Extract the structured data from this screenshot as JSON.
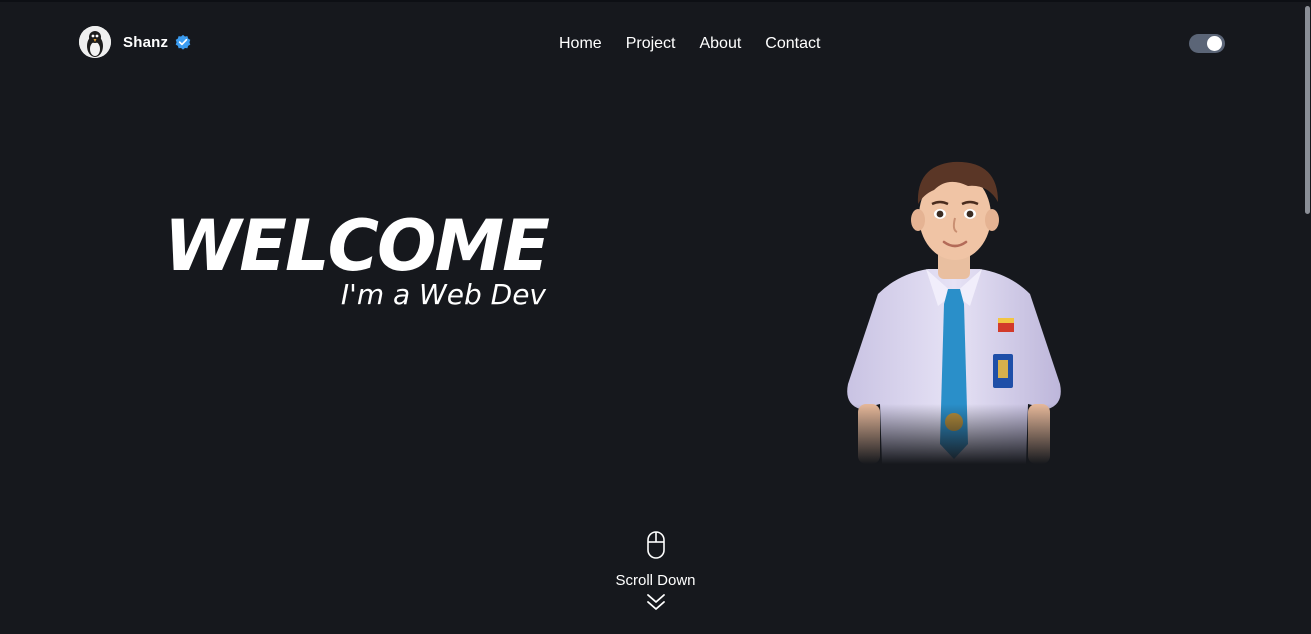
{
  "brand": {
    "name": "Shanz",
    "avatar_icon": "penguin-avatar",
    "verified_icon": "verified-badge-icon",
    "verified_color": "#3b9cf0"
  },
  "nav": {
    "items": [
      {
        "label": "Home"
      },
      {
        "label": "Project"
      },
      {
        "label": "About"
      },
      {
        "label": "Contact"
      }
    ]
  },
  "theme_toggle": {
    "state": "on",
    "track_color": "#5b6577"
  },
  "hero": {
    "title": "WELCOME",
    "subtitle": "I'm a Web Dev",
    "portrait": "cartoon-student-portrait"
  },
  "scroll": {
    "label": "Scroll Down",
    "mouse_icon": "mouse-icon",
    "chevron_icon": "double-chevron-down-icon"
  },
  "colors": {
    "background": "#16181d",
    "text": "#ffffff"
  }
}
